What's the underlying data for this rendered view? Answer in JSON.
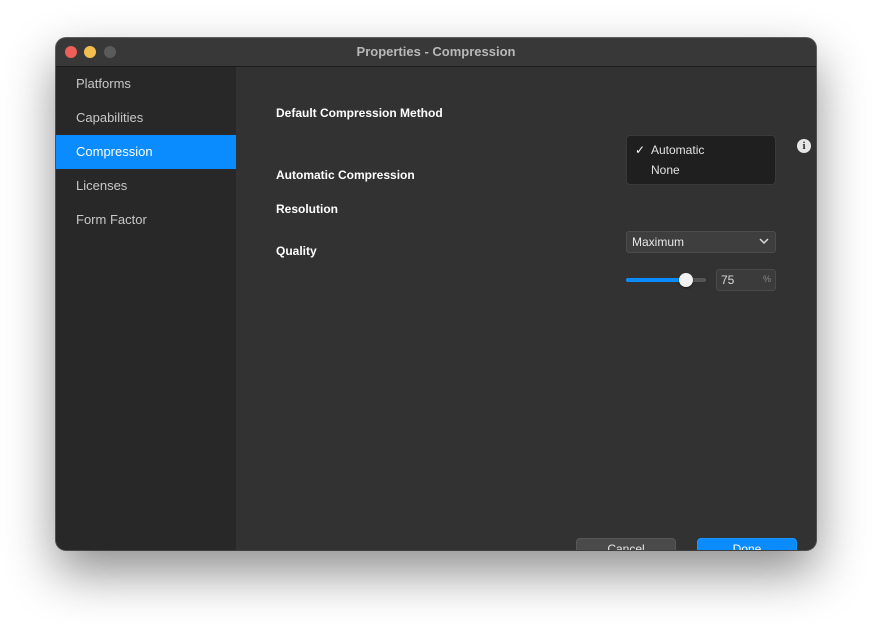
{
  "window": {
    "title": "Properties - Compression"
  },
  "sidebar": {
    "items": [
      {
        "label": "Platforms",
        "active": false
      },
      {
        "label": "Capabilities",
        "active": false
      },
      {
        "label": "Compression",
        "active": true
      },
      {
        "label": "Licenses",
        "active": false
      },
      {
        "label": "Form Factor",
        "active": false
      }
    ]
  },
  "compression": {
    "default_method_label": "Default Compression Method",
    "method_options": [
      "Automatic",
      "None"
    ],
    "selected_method": "Automatic",
    "check_glyph": "✓",
    "auto_section_label": "Automatic Compression",
    "resolution_label": "Resolution",
    "resolution_value": "Maximum",
    "quality_label": "Quality",
    "quality_value": "75",
    "quality_unit": "%",
    "quality_percent": 75,
    "info_icon_glyph": "i"
  },
  "buttons": {
    "cancel": "Cancel",
    "done": "Done"
  },
  "colors": {
    "accent": "#0a8cff",
    "close": "#ee5f57",
    "minimize": "#f4bd4f",
    "zoom_disabled": "#5a5a5a"
  }
}
